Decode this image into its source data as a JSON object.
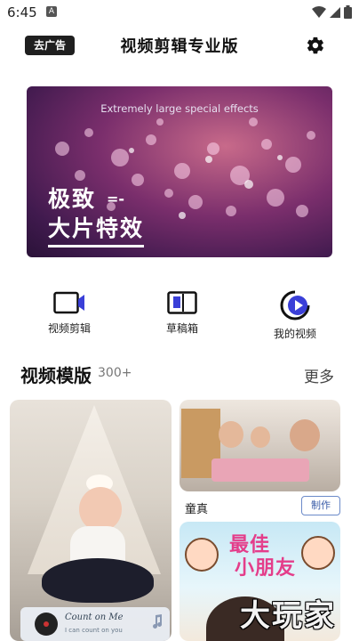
{
  "status_bar": {
    "time": "6:45",
    "notification_letter": "A",
    "icons": [
      "wifi-icon",
      "signal-icon",
      "battery-icon"
    ]
  },
  "app_bar": {
    "ad_button": "去广告",
    "title": "视频剪辑专业版",
    "settings_icon": "gear-icon"
  },
  "banner": {
    "subtitle": "Extremely large special effects",
    "line1": "极致",
    "dash": "=-",
    "line2": "大片特效"
  },
  "quick_actions": [
    {
      "label": "视频剪辑",
      "icon": "video-camera-icon"
    },
    {
      "label": "草稿箱",
      "icon": "drafts-icon"
    },
    {
      "label": "我的视频",
      "icon": "play-circle-icon"
    }
  ],
  "section": {
    "title": "视频模版",
    "count": "300+",
    "more": "更多"
  },
  "templates": {
    "left_music": {
      "title": "Count on Me",
      "subtitle": "I can count on you"
    },
    "right_top": {
      "label": "童真",
      "make_button": "制作"
    },
    "right_bottom": {
      "text_line1": "最佳",
      "text_line2": "小朋友"
    }
  },
  "watermark": "大玩家",
  "colors": {
    "accent_button": "#1f1f1f",
    "make_button_border": "#6b8ac9",
    "banner_pink": "#c86a8a",
    "badge_pink": "#e43d8a"
  }
}
